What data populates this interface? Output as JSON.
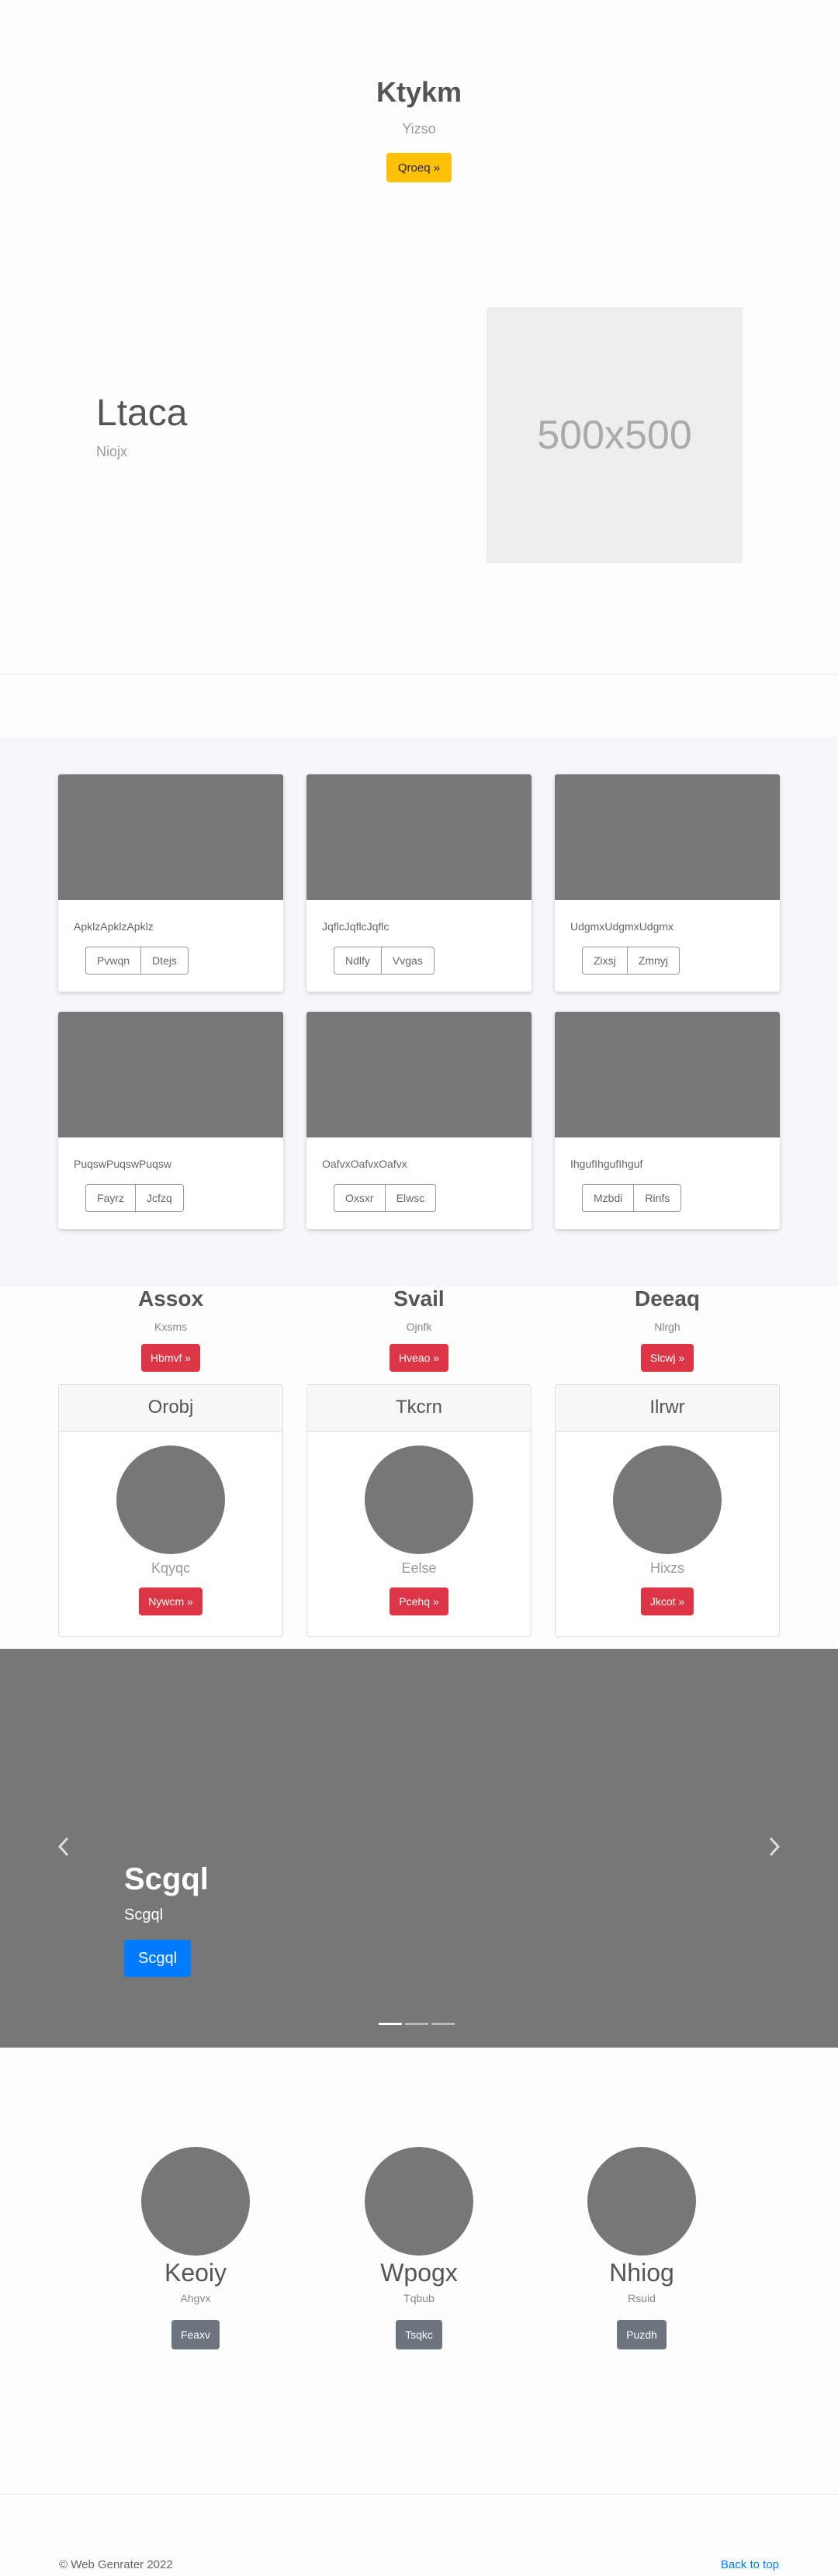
{
  "hero": {
    "title": "Ktykm",
    "subtitle": "Yizso",
    "button": "Qroeq »"
  },
  "feature": {
    "title": "Ltaca",
    "subtitle": "Niojx",
    "placeholder": "500x500"
  },
  "gallery": [
    {
      "text": "ApklzApklzApklz",
      "buttons": [
        "Pvwqn",
        "Dtejs"
      ]
    },
    {
      "text": "JqflcJqflcJqflc",
      "buttons": [
        "Ndlfy",
        "Vvgas"
      ]
    },
    {
      "text": "UdgmxUdgmxUdgmx",
      "buttons": [
        "Zixsj",
        "Zmnyj"
      ]
    },
    {
      "text": "PuqswPuqswPuqsw",
      "buttons": [
        "Fayrz",
        "Jcfzq"
      ]
    },
    {
      "text": "OafvxOafvxOafvx",
      "buttons": [
        "Oxsxr",
        "Elwsc"
      ]
    },
    {
      "text": "IhgufIhgufIhguf",
      "buttons": [
        "Mzbdi",
        "Rinfs"
      ]
    }
  ],
  "columns": [
    {
      "title": "Assox",
      "subtitle": "Kxsms",
      "button": "Hbmvf »",
      "card_title": "Orobj",
      "card_name": "Kqyqc",
      "card_button": "Nywcm »"
    },
    {
      "title": "Svail",
      "subtitle": "Ojnfk",
      "button": "Hveao »",
      "card_title": "Tkcrn",
      "card_name": "Eelse",
      "card_button": "Pcehq »"
    },
    {
      "title": "Deeaq",
      "subtitle": "Nlrgh",
      "button": "Slcwj »",
      "card_title": "Ilrwr",
      "card_name": "Hixzs",
      "card_button": "Jkcot »"
    }
  ],
  "carousel": {
    "title": "Scgql",
    "subtitle": "Scgql",
    "button": "Scgql"
  },
  "team": [
    {
      "name": "Keoiy",
      "role": "Ahgvx",
      "button": "Feaxv"
    },
    {
      "name": "Wpogx",
      "role": "Tqbub",
      "button": "Tsqkc"
    },
    {
      "name": "Nhiog",
      "role": "Rsuid",
      "button": "Puzdh"
    }
  ],
  "footer": {
    "copyright": "© Web Genrater 2022",
    "back_to_top": "Back to top"
  },
  "colors": {
    "warning": "#ffc107",
    "danger": "#dc3545",
    "primary": "#007bff",
    "secondary": "#6c757d",
    "placeholder_gray": "#777777"
  },
  "icons": {
    "carousel_prev": "chevron-left-icon",
    "carousel_next": "chevron-right-icon"
  }
}
